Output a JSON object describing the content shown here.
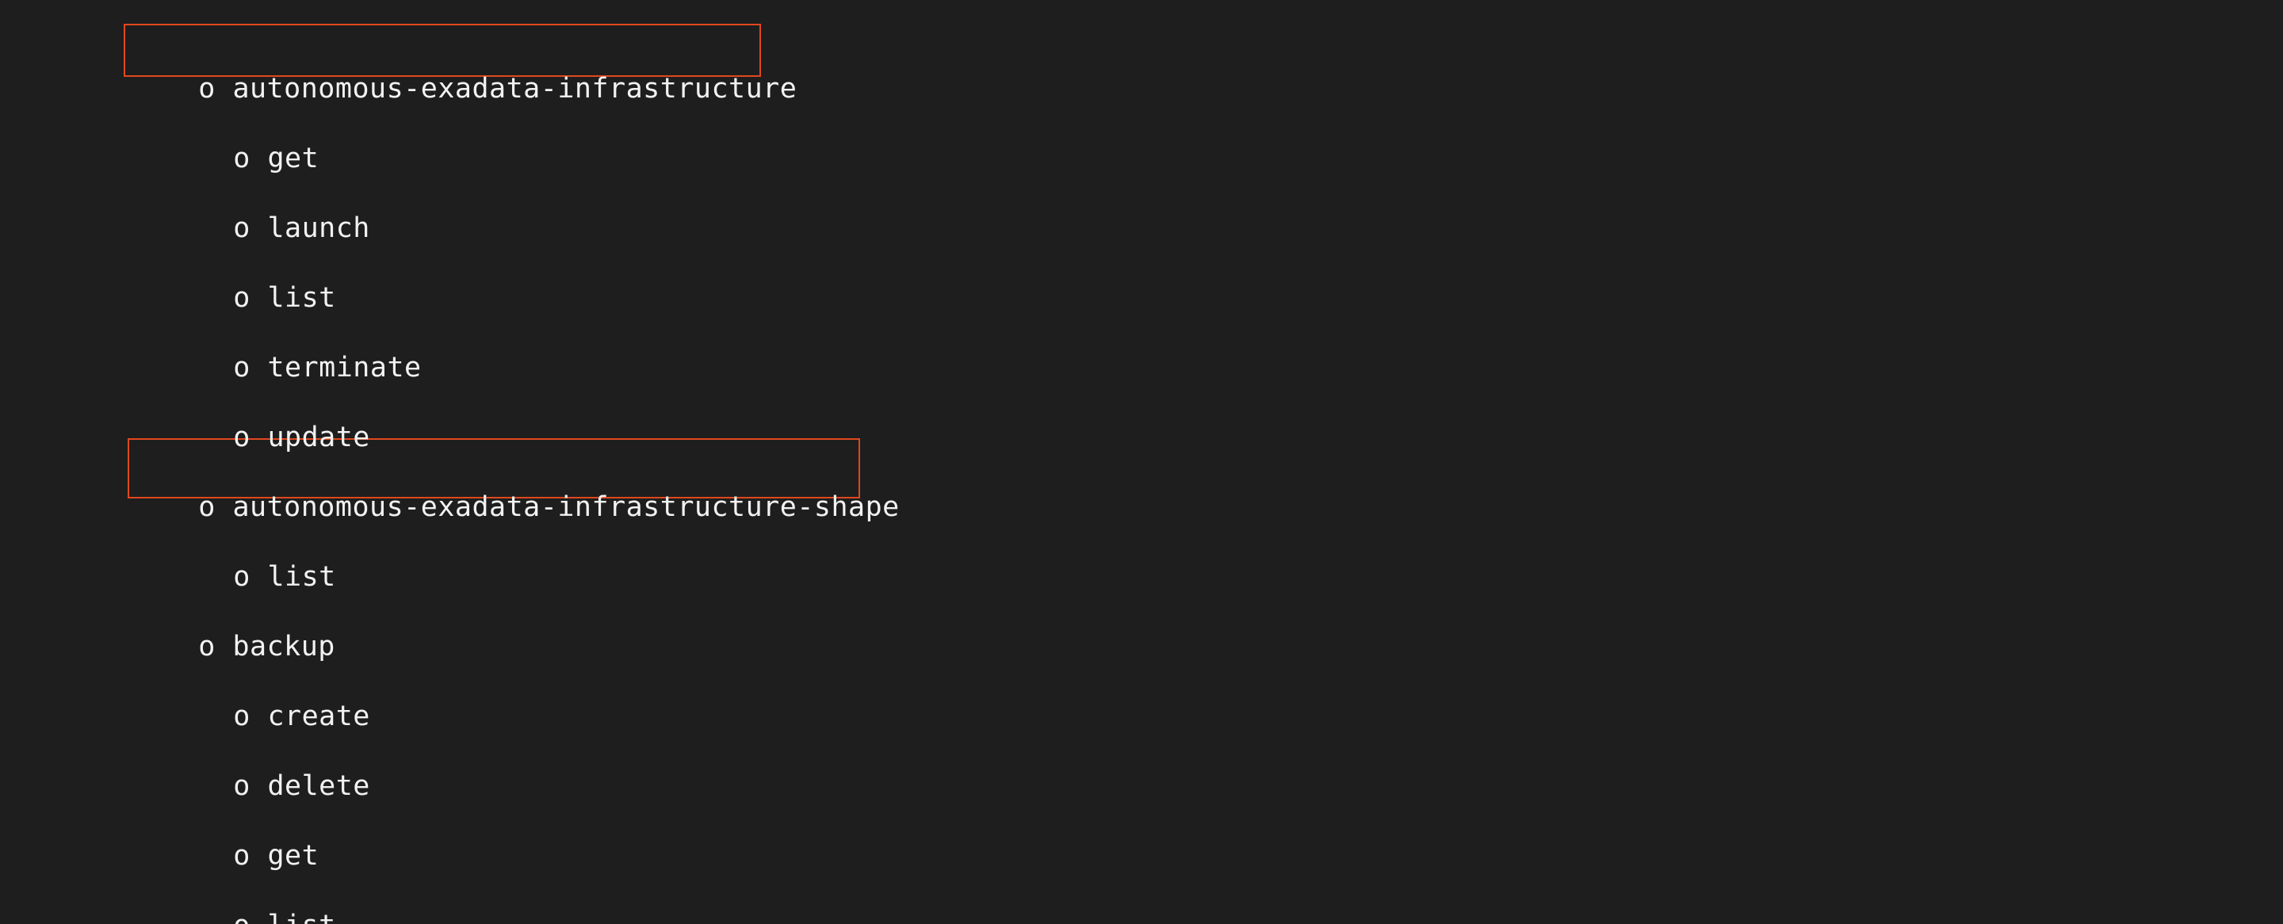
{
  "terminal": {
    "lines": [
      {
        "level": 0,
        "bullet": "o",
        "text": "autonomous-exadata-infrastructure",
        "highlighted": true
      },
      {
        "level": 1,
        "bullet": "o",
        "text": "get"
      },
      {
        "level": 1,
        "bullet": "o",
        "text": "launch"
      },
      {
        "level": 1,
        "bullet": "o",
        "text": "list"
      },
      {
        "level": 1,
        "bullet": "o",
        "text": "terminate"
      },
      {
        "level": 1,
        "bullet": "o",
        "text": "update"
      },
      {
        "level": 0,
        "bullet": "o",
        "text": "autonomous-exadata-infrastructure-shape",
        "highlighted": true
      },
      {
        "level": 1,
        "bullet": "o",
        "text": "list"
      },
      {
        "level": 0,
        "bullet": "o",
        "text": "backup"
      },
      {
        "level": 1,
        "bullet": "o",
        "text": "create"
      },
      {
        "level": 1,
        "bullet": "o",
        "text": "delete"
      },
      {
        "level": 1,
        "bullet": "o",
        "text": "get"
      },
      {
        "level": 1,
        "bullet": "o",
        "text": "list"
      }
    ],
    "highlight_color": "#e0481f",
    "background_color": "#1e1e1e",
    "text_color": "#f2f2f2"
  }
}
